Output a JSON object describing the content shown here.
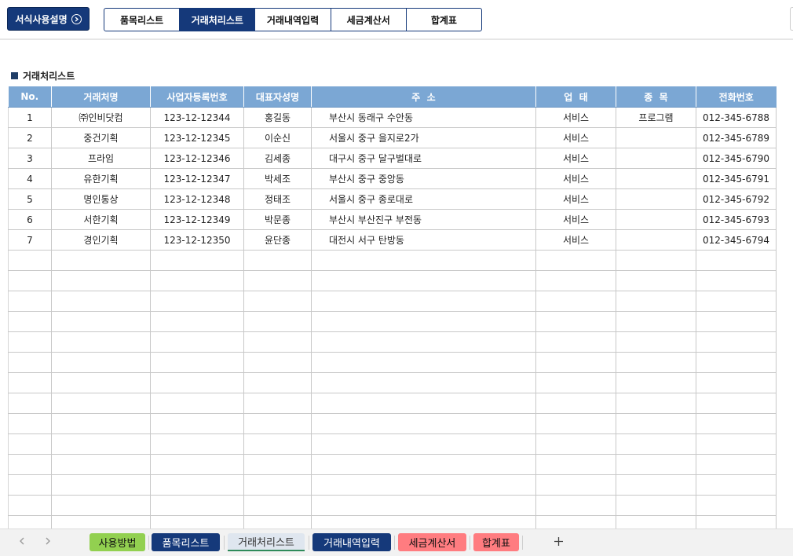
{
  "header": {
    "help_button": "서식사용설명",
    "nav_tabs": [
      {
        "label": "품목리스트",
        "active": false
      },
      {
        "label": "거래처리스트",
        "active": true
      },
      {
        "label": "거래내역입력",
        "active": false
      },
      {
        "label": "세금계산서",
        "active": false
      },
      {
        "label": "합계표",
        "active": false
      }
    ]
  },
  "section_title": "거래처리스트",
  "table": {
    "columns": [
      "No.",
      "거래처명",
      "사업자등록번호",
      "대표자성명",
      "주  소",
      "업  태",
      "종  목",
      "전화번호"
    ],
    "rows": [
      [
        "1",
        "㈜인비닷컴",
        "123-12-12344",
        "홍길동",
        "부산시 동래구 수안동",
        "서비스",
        "프로그램",
        "012-345-6788"
      ],
      [
        "2",
        "중건기획",
        "123-12-12345",
        "이순신",
        "서울시 중구 을지로2가",
        "서비스",
        "",
        "012-345-6789"
      ],
      [
        "3",
        "프라임",
        "123-12-12346",
        "김세종",
        "대구시 중구 달구벌대로",
        "서비스",
        "",
        "012-345-6790"
      ],
      [
        "4",
        "유한기획",
        "123-12-12347",
        "박세조",
        "부산시 중구 중앙동",
        "서비스",
        "",
        "012-345-6791"
      ],
      [
        "5",
        "명인통상",
        "123-12-12348",
        "정태조",
        "서울시 중구 종로대로",
        "서비스",
        "",
        "012-345-6792"
      ],
      [
        "6",
        "서한기획",
        "123-12-12349",
        "박문종",
        "부산시 부산진구 부전동",
        "서비스",
        "",
        "012-345-6793"
      ],
      [
        "7",
        "경인기획",
        "123-12-12350",
        "윤단종",
        "대전시 서구 탄방동",
        "서비스",
        "",
        "012-345-6794"
      ]
    ],
    "empty_rows": 14
  },
  "sheet_tabs": [
    {
      "label": "사용방법",
      "style": "green"
    },
    {
      "label": "품목리스트",
      "style": "navy"
    },
    {
      "label": "거래처리스트",
      "style": "current"
    },
    {
      "label": "거래내역입력",
      "style": "navy"
    },
    {
      "label": "세금계산서",
      "style": "pink"
    },
    {
      "label": "합계표",
      "style": "pink"
    }
  ],
  "icons": {
    "help": "chevron-right-circle-icon",
    "prev": "chevron-left-icon",
    "next": "chevron-right-icon",
    "add_sheet": "plus-icon"
  },
  "colors": {
    "navy": "#15397a",
    "header_blue": "#7ba7d4",
    "tab_green": "#92d050",
    "tab_pink": "#ff7c80"
  }
}
